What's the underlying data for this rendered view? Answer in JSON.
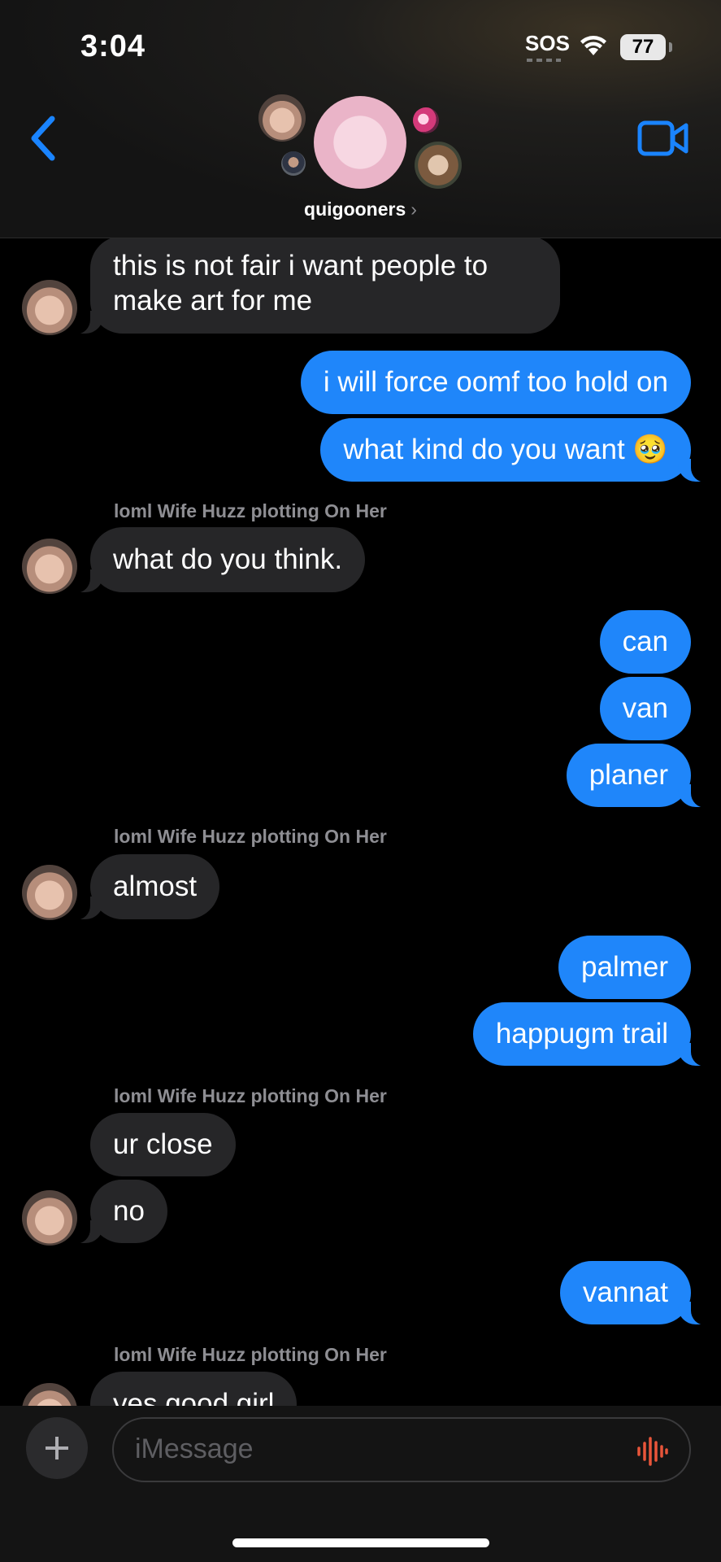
{
  "status_bar": {
    "time": "3:04",
    "sos": "SOS",
    "battery": "77"
  },
  "header": {
    "group_name": "quigooners",
    "chevron": "›"
  },
  "messages": [
    {
      "direction": "in",
      "text_lines": [
        "this is not fair i want people to",
        "make art for me"
      ]
    },
    {
      "direction": "out",
      "text": "i will force oomf too hold on"
    },
    {
      "direction": "out",
      "text": "what kind do you want 🥹"
    },
    {
      "direction": "in",
      "sender": "loml Wife Huzz plotting On Her",
      "text": "what do you think."
    },
    {
      "direction": "out",
      "text": "can"
    },
    {
      "direction": "out",
      "text": "van"
    },
    {
      "direction": "out",
      "text": "planer"
    },
    {
      "direction": "in",
      "sender": "loml Wife Huzz plotting On Her",
      "text": "almost"
    },
    {
      "direction": "out",
      "text": "palmer"
    },
    {
      "direction": "out",
      "text": "happugm trail"
    },
    {
      "direction": "in",
      "sender": "loml Wife Huzz plotting On Her",
      "text": "ur close"
    },
    {
      "direction": "in",
      "text": "no"
    },
    {
      "direction": "out",
      "text": "vannat"
    },
    {
      "direction": "in",
      "sender": "loml Wife Huzz plotting On Her",
      "text": "yes good girl"
    }
  ],
  "composer": {
    "placeholder": "iMessage"
  },
  "icons": [
    "back-chevron-icon",
    "video-camera-icon",
    "plus-icon",
    "audio-waveform-icon",
    "wifi-icon"
  ],
  "colors": {
    "outgoing_bubble": "#1f86fa",
    "incoming_bubble": "#262628",
    "accent": "#1a84ff",
    "mic": "#e8553a"
  }
}
